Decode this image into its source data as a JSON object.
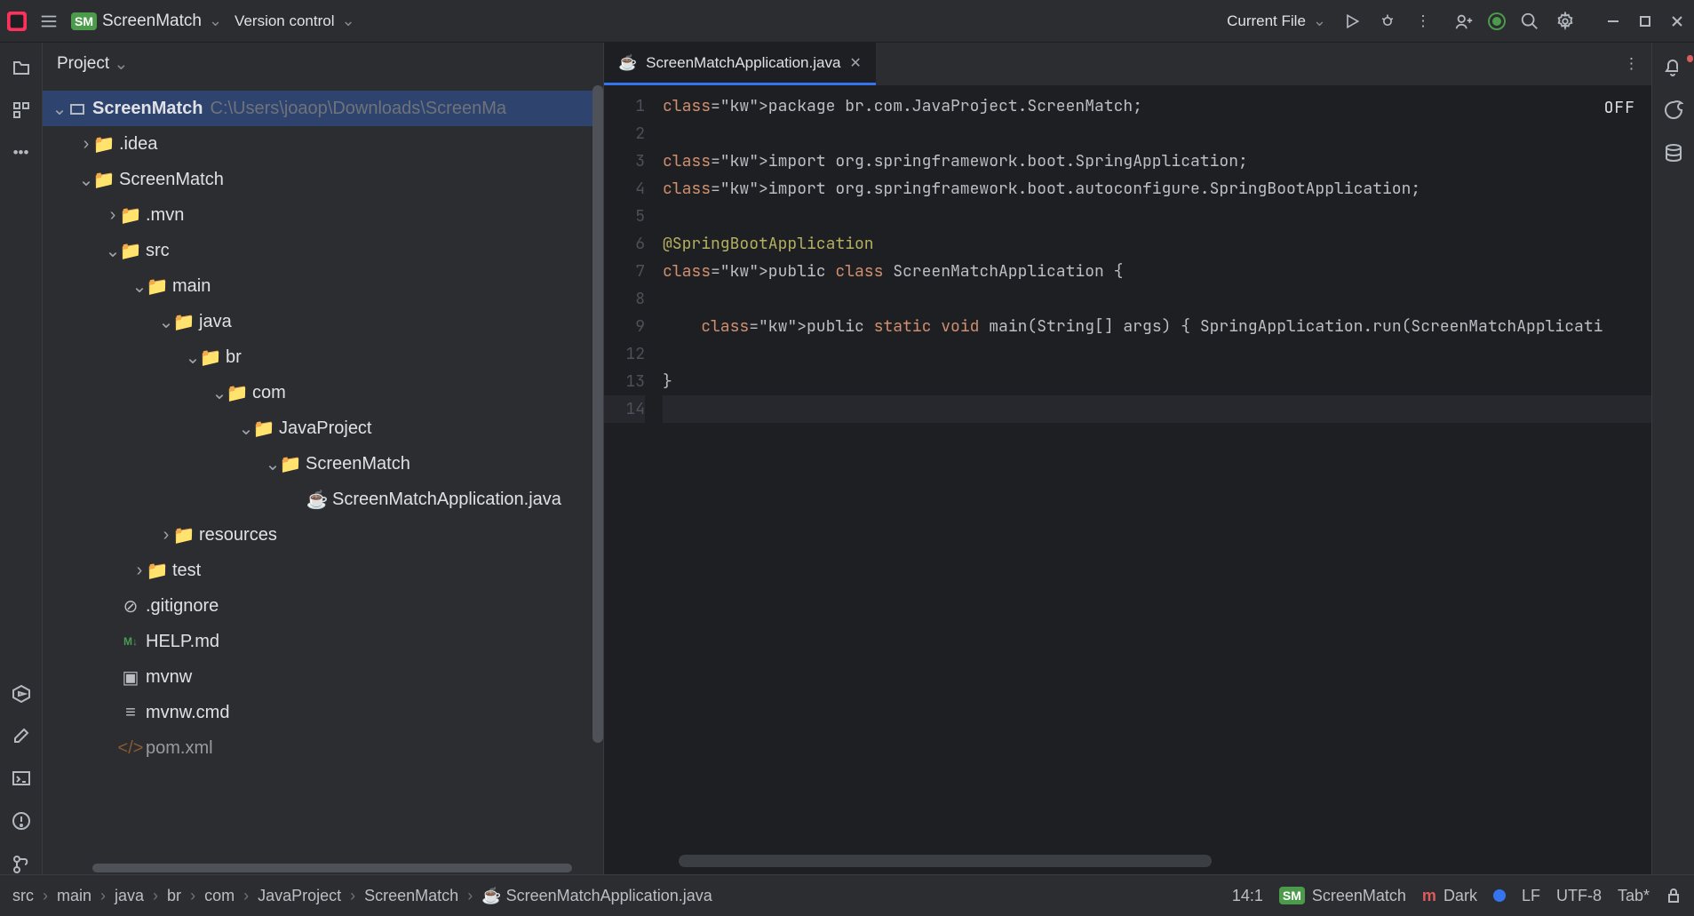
{
  "titlebar": {
    "project_badge": "SM",
    "project_name": "ScreenMatch",
    "vcs_label": "Version control",
    "run_config": "Current File"
  },
  "project_panel": {
    "title": "Project"
  },
  "tree": {
    "root": {
      "name": "ScreenMatch",
      "path": "C:\\Users\\joaop\\Downloads\\ScreenMa"
    },
    "idea": ".idea",
    "module": "ScreenMatch",
    "mvn": ".mvn",
    "src": "src",
    "main": "main",
    "java": "java",
    "br": "br",
    "com": "com",
    "javaproject": "JavaProject",
    "screenmatch": "ScreenMatch",
    "appfile": "ScreenMatchApplication.java",
    "resources": "resources",
    "test": "test",
    "gitignore": ".gitignore",
    "help": "HELP.md",
    "mvnw": "mvnw",
    "mvnwcmd": "mvnw.cmd",
    "pom": "pom.xml"
  },
  "editor": {
    "tab_label": "ScreenMatchApplication.java",
    "off_label": "OFF",
    "code_lines": [
      "package br.com.JavaProject.ScreenMatch;",
      "",
      "import org.springframework.boot.SpringApplication;",
      "import org.springframework.boot.autoconfigure.SpringBootApplication;",
      "",
      "@SpringBootApplication",
      "public class ScreenMatchApplication {",
      "",
      "    public static void main(String[] args) { SpringApplication.run(ScreenMatchApplicati",
      "",
      "}",
      ""
    ]
  },
  "gutter": [
    "1",
    "2",
    "3",
    "4",
    "5",
    "6",
    "7",
    "8",
    "9",
    "12",
    "13",
    "14"
  ],
  "breadcrumbs": [
    "src",
    "main",
    "java",
    "br",
    "com",
    "JavaProject",
    "ScreenMatch",
    "ScreenMatchApplication.java"
  ],
  "status": {
    "position": "14:1",
    "badge": "SM",
    "module": "ScreenMatch",
    "theme": "Dark",
    "linesep": "LF",
    "encoding": "UTF-8",
    "indent": "Tab*"
  }
}
